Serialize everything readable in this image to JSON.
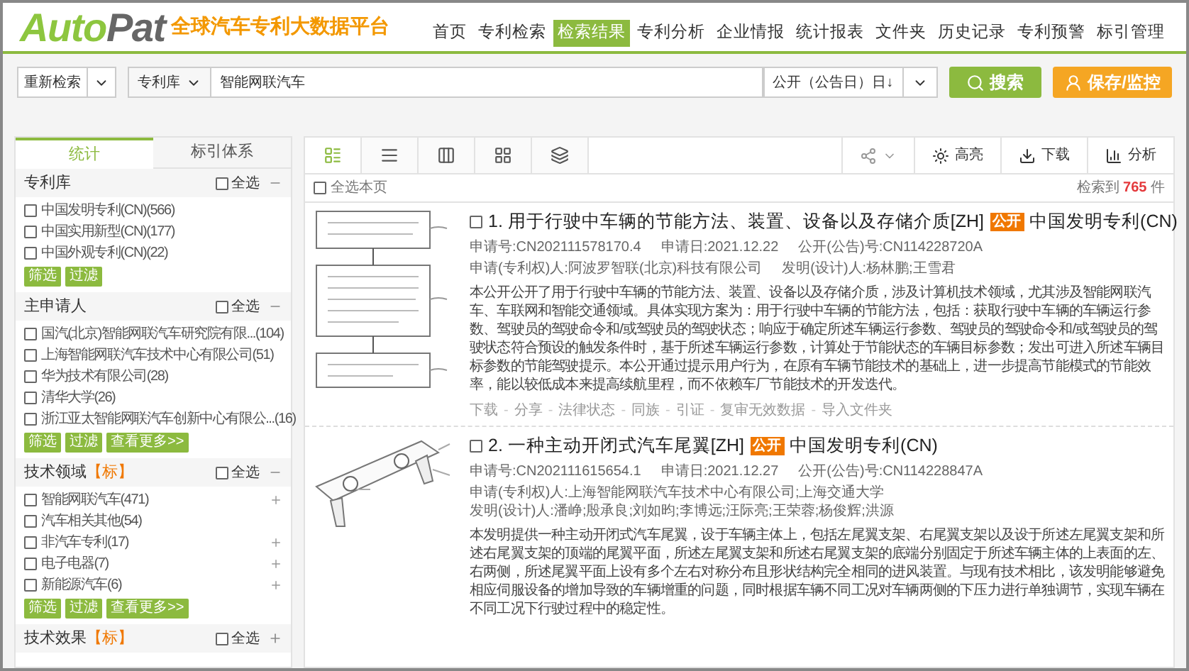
{
  "header": {
    "logo": {
      "part_1": "Auto",
      "part_2": "Pat"
    },
    "slogan": "全球汽车专利大数据平台",
    "nav": [
      {
        "label": "首页",
        "selected": false
      },
      {
        "label": "专利检索",
        "selected": false
      },
      {
        "label": "检索结果",
        "selected": true
      },
      {
        "label": "专利分析",
        "selected": false
      },
      {
        "label": "企业情报",
        "selected": false
      },
      {
        "label": "统计报表",
        "selected": false
      },
      {
        "label": "文件夹",
        "selected": false
      },
      {
        "label": "历史记录",
        "selected": false
      },
      {
        "label": "专利预警",
        "selected": false
      },
      {
        "label": "标引管理",
        "selected": false
      }
    ]
  },
  "search": {
    "mode_select": "重新检索",
    "database_select": "专利库",
    "query": "智能网联汽车",
    "sort_select": "公开（公告日）日↓",
    "search_button": "搜索",
    "save_button": "保存/监控"
  },
  "sidebar": {
    "tabs": [
      {
        "label": "统计",
        "selected": true
      },
      {
        "label": "标引体系",
        "selected": false
      }
    ],
    "sections": [
      {
        "title": "专利库",
        "select_all": {
          "label": "全选",
          "checked": false
        },
        "expanded": true,
        "items": [
          {
            "label": "中国发明专利(CN)(566)",
            "checked": false,
            "expandable": false
          },
          {
            "label": "中国实用新型(CN)(177)",
            "checked": false,
            "expandable": false
          },
          {
            "label": "中国外观专利(CN)(22)",
            "checked": false,
            "expandable": false
          }
        ],
        "actions": [
          "筛选",
          "过滤"
        ]
      },
      {
        "title": "主申请人",
        "select_all": {
          "label": "全选",
          "checked": false
        },
        "expanded": true,
        "items": [
          {
            "label": "国汽(北京)智能网联汽车研究院有限...(104)",
            "checked": false,
            "expandable": false
          },
          {
            "label": "上海智能网联汽车技术中心有限公司(51)",
            "checked": false,
            "expandable": false
          },
          {
            "label": "华为技术有限公司(28)",
            "checked": false,
            "expandable": false
          },
          {
            "label": "清华大学(26)",
            "checked": false,
            "expandable": false
          },
          {
            "label": "浙江亚太智能网联汽车创新中心有限公...(16)",
            "checked": false,
            "expandable": false
          }
        ],
        "actions": [
          "筛选",
          "过滤",
          "查看更多>>"
        ]
      },
      {
        "title": "技术领域",
        "tag": "【标】",
        "select_all": {
          "label": "全选",
          "checked": false
        },
        "expanded": true,
        "items": [
          {
            "label": "智能网联汽车(471)",
            "checked": false,
            "expandable": true
          },
          {
            "label": "汽车相关其他(54)",
            "checked": false,
            "expandable": false
          },
          {
            "label": "非汽车专利(17)",
            "checked": false,
            "expandable": true
          },
          {
            "label": "电子电器(7)",
            "checked": false,
            "expandable": true
          },
          {
            "label": "新能源汽车(6)",
            "checked": false,
            "expandable": true
          }
        ],
        "actions": [
          "筛选",
          "过滤",
          "查看更多>>"
        ]
      },
      {
        "title": "技术效果",
        "tag": "【标】",
        "select_all": {
          "label": "全选",
          "checked": false
        },
        "expanded": false
      }
    ]
  },
  "toolbar": {
    "views": [
      {
        "kind": "detail",
        "selected": true
      },
      {
        "kind": "list",
        "selected": false
      },
      {
        "kind": "columns",
        "selected": false
      },
      {
        "kind": "grid",
        "selected": false
      },
      {
        "kind": "layers",
        "selected": false
      }
    ],
    "tools": [
      {
        "kind": "share"
      },
      {
        "kind": "highlight",
        "label": "高亮"
      },
      {
        "kind": "download",
        "label": "下载"
      },
      {
        "kind": "analyze",
        "label": "分析"
      }
    ]
  },
  "select_page": {
    "label": "全选本页",
    "checked": false
  },
  "result_count": {
    "prefix": "检索到",
    "count": "765",
    "suffix": "件"
  },
  "results": [
    {
      "checked": false,
      "number": "1.",
      "title": "用于行驶中车辆的节能方法、装置、设备以及存储介质[ZH]",
      "status": "公开",
      "type": "中国发明专利(CN)",
      "meta": [
        [
          "申请号:CN202111578170.4",
          "申请日:2021.12.22",
          "公开(公告)号:CN114228720A"
        ],
        [
          "申请(专利权)人:阿波罗智联(北京)科技有限公司",
          "发明(设计)人:杨林鹏;王雪君"
        ]
      ],
      "abstract": "本公开公开了用于行驶中车辆的节能方法、装置、设备以及存储介质，涉及计算机技术领域，尤其涉及智能网联汽车、车联网和智能交通领域。具体实现方案为：用于行驶中车辆的节能方法，包括：获取行驶中车辆的车辆运行参数、驾驶员的驾驶命令和/或驾驶员的驾驶状态；响应于确定所述车辆运行参数、驾驶员的驾驶命令和/或驾驶员的驾驶状态符合预设的触发条件时，基于所述车辆运行参数，计算处于节能状态的车辆目标参数；发出可进入所述车辆目标参数的节能驾驶提示。本公开通过提示用户行为，在原有车辆节能技术的基础上，进一步提高节能模式的节能效率，能以较低成本来提高续航里程，而不依赖车厂节能技术的开发迭代。",
      "actions": [
        {
          "kind": "link",
          "label": "下载"
        },
        {
          "kind": "sep",
          "label": "-"
        },
        {
          "kind": "link",
          "label": "分享"
        },
        {
          "kind": "sep",
          "label": "-"
        },
        {
          "kind": "link",
          "label": "法律状态"
        },
        {
          "kind": "sep",
          "label": "-"
        },
        {
          "kind": "link",
          "label": "同族"
        },
        {
          "kind": "sep",
          "label": "-"
        },
        {
          "kind": "link",
          "label": "引证"
        },
        {
          "kind": "sep",
          "label": "-"
        },
        {
          "kind": "link",
          "label": "复审无效数据"
        },
        {
          "kind": "sep",
          "label": "-"
        },
        {
          "kind": "link",
          "label": "导入文件夹"
        }
      ]
    },
    {
      "checked": false,
      "number": "2.",
      "title": "一种主动开闭式汽车尾翼[ZH]",
      "status": "公开",
      "type": "中国发明专利(CN)",
      "meta": [
        [
          "申请号:CN202111615654.1",
          "申请日:2021.12.27",
          "公开(公告)号:CN114228847A"
        ],
        [
          "申请(专利权)人:上海智能网联汽车技术中心有限公司;上海交通大学",
          "发明(设计)人:潘峥;殷承良;刘如昀;李博远;汪际亮;王荣蓉;杨俊辉;洪源"
        ]
      ],
      "abstract": "本发明提供一种主动开闭式汽车尾翼，设于车辆主体上，包括左尾翼支架、右尾翼支架以及设于所述左尾翼支架和所述右尾翼支架的顶端的尾翼平面，所述左尾翼支架和所述右尾翼支架的底端分别固定于所述车辆主体的上表面的左、右两侧，所述尾翼平面上设有多个左右对称分布且形状结构完全相同的进风装置。与现有技术相比，该发明能够避免相应伺服设备的增加导致的车辆增重的问题，同时根据车辆不同工况对车辆两侧的下压力进行单独调节，实现车辆在不同工况下行驶过程中的稳定性。"
    }
  ]
}
